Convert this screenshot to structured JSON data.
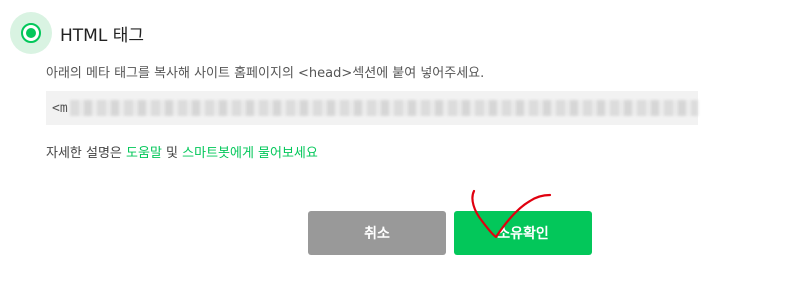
{
  "option": {
    "label": "HTML 태그",
    "selected": true
  },
  "instruction": "아래의 메타 태그를 복사해 사이트 홈페이지의 <head>섹션에 붙여 넣어주세요.",
  "code_box": {
    "visible_prefix": "<m"
  },
  "help": {
    "prefix": "자세한 설명은 ",
    "link1": "도움말",
    "middle": " 및 ",
    "link2": "스마트봇에게 물어보세요"
  },
  "buttons": {
    "cancel": "취소",
    "confirm": "소유확인"
  },
  "colors": {
    "accent": "#03c75a",
    "cancel_bg": "#999999",
    "annotation": "#e0000f"
  }
}
